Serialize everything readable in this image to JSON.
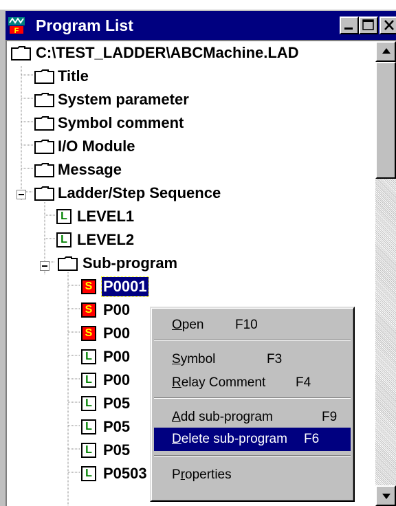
{
  "window": {
    "title": "Program List"
  },
  "tree": {
    "root": "C:\\TEST_LADDER\\ABCMachine.LAD",
    "items": [
      {
        "label": "Title"
      },
      {
        "label": "System parameter"
      },
      {
        "label": "Symbol comment"
      },
      {
        "label": "I/O Module"
      },
      {
        "label": "Message"
      },
      {
        "label": "Ladder/Step Sequence"
      },
      {
        "label": "LEVEL1",
        "badge": "L"
      },
      {
        "label": "LEVEL2",
        "badge": "L"
      },
      {
        "label": "Sub-program"
      },
      {
        "label": "P0001",
        "badge": "S"
      },
      {
        "label": "P00",
        "badge": "S"
      },
      {
        "label": "P00",
        "badge": "S"
      },
      {
        "label": "P00",
        "badge": "L"
      },
      {
        "label": "P00",
        "badge": "L"
      },
      {
        "label": "P05",
        "badge": "L"
      },
      {
        "label": "P05",
        "badge": "L"
      },
      {
        "label": "P05",
        "badge": "L"
      },
      {
        "label": "P0503",
        "badge": "L"
      }
    ]
  },
  "context_menu": {
    "items": [
      {
        "label": "Open",
        "accel": "O",
        "rest": "pen",
        "key": "F10"
      },
      {
        "label": "Symbol",
        "accel": "S",
        "rest": "ymbol",
        "key": "F3"
      },
      {
        "label": "Relay Comment",
        "accel": "R",
        "rest": "elay Comment",
        "key": "F4"
      },
      {
        "label": "Add sub-program",
        "accel": "A",
        "rest": "dd sub-program",
        "key": "F9"
      },
      {
        "label": "Delete sub-program",
        "accel": "D",
        "rest": "elete sub-program",
        "key": "F6"
      },
      {
        "label": "Properties",
        "accel": "r",
        "pre": "P",
        "rest": "operties",
        "key": ""
      }
    ],
    "selected": "Delete sub-program"
  },
  "colors": {
    "title_bar": "#000080",
    "selection": "#000080",
    "sub_badge": "#ff0000",
    "ladder_badge_text": "#008000"
  }
}
